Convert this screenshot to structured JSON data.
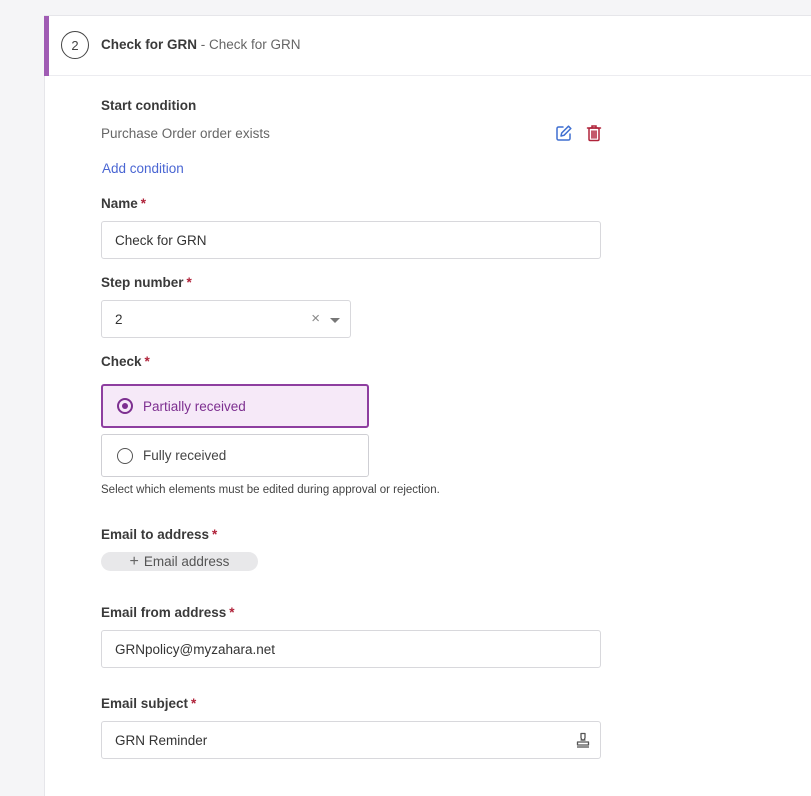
{
  "step": {
    "number": "2",
    "title": "Check for GRN",
    "separator": " - ",
    "subtitle": "Check for GRN"
  },
  "start_condition": {
    "label": "Start condition",
    "value": "Purchase Order order exists",
    "edit_icon": "edit-icon",
    "delete_icon": "trash-icon",
    "add_link": "Add condition"
  },
  "name_field": {
    "label": "Name",
    "required": "*",
    "value": "Check for GRN"
  },
  "step_number": {
    "label": "Step number",
    "required": "*",
    "value": "2",
    "clear": "×"
  },
  "check": {
    "label": "Check",
    "required": "*",
    "options": [
      {
        "label": "Partially received",
        "selected": true
      },
      {
        "label": "Fully received",
        "selected": false
      }
    ],
    "help": "Select which elements must be edited during approval or rejection."
  },
  "email_to": {
    "label": "Email to address",
    "required": "*",
    "add_chip": "Email address",
    "plus": "+"
  },
  "email_from": {
    "label": "Email from address",
    "required": "*",
    "value": "GRNpolicy@myzahara.net"
  },
  "email_subject": {
    "label": "Email subject",
    "required": "*",
    "value": "GRN Reminder",
    "icon": "stamp-icon"
  },
  "colors": {
    "accent": "#a05cb4",
    "selected_border": "#8e3ea0",
    "selected_bg": "#f6e9f8",
    "link": "#4a66d3",
    "required": "#b0233a",
    "edit_icon": "#3f6fd1",
    "delete_icon": "#b0233a"
  }
}
